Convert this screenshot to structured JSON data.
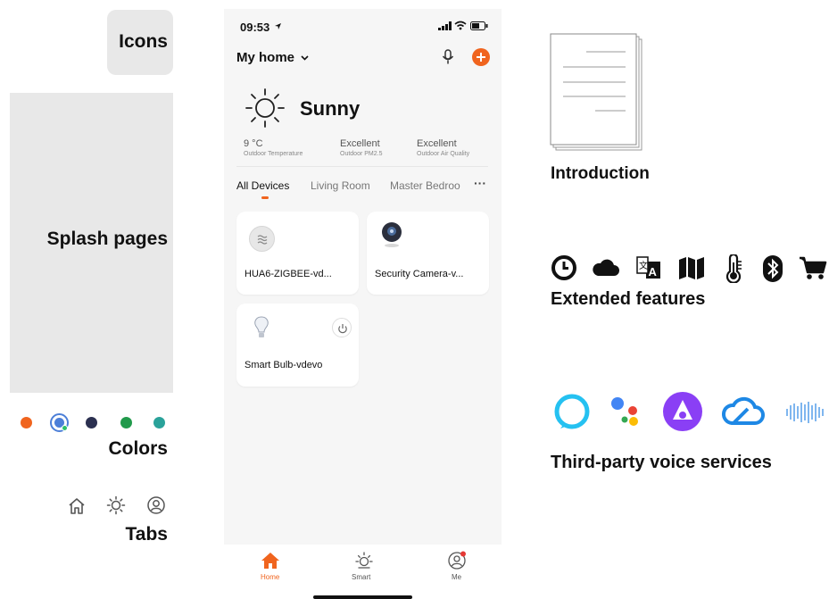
{
  "labels": {
    "icons": "Icons",
    "splash": "Splash pages",
    "colors": "Colors",
    "tabs": "Tabs",
    "introduction": "Introduction",
    "extended": "Extended features",
    "voice": "Third-party voice services"
  },
  "colors": [
    "#f0641e",
    "#4c7fd8",
    "#2b3050",
    "#219a4b",
    "#2aa29a"
  ],
  "accent": "#f0641e",
  "tab_icons": [
    "home-icon",
    "sun-icon",
    "user-icon"
  ],
  "extended_icons": [
    "clock-icon",
    "cloud-icon",
    "translate-icon",
    "map-icon",
    "thermometer-icon",
    "bluetooth-icon",
    "cart-icon"
  ],
  "voice_icons": [
    "alexa-icon",
    "google-assistant-icon",
    "alice-icon",
    "tencent-cloud-icon",
    "duer-icon"
  ],
  "phone": {
    "status_time": "09:53",
    "home_name": "My home",
    "weather": "Sunny",
    "stats": [
      {
        "value": "9 °C",
        "label": "Outdoor Temperature"
      },
      {
        "value": "Excellent",
        "label": "Outdoor PM2.5"
      },
      {
        "value": "Excellent",
        "label": "Outdoor Air Quality"
      }
    ],
    "room_tabs": [
      "All Devices",
      "Living Room",
      "Master Bedroo"
    ],
    "more": "···",
    "devices": [
      {
        "name": "HUA6-ZIGBEE-vd..."
      },
      {
        "name": "Security Camera-v..."
      },
      {
        "name": "Smart Bulb-vdevo"
      }
    ],
    "tabbar": [
      "Home",
      "Smart",
      "Me"
    ]
  }
}
